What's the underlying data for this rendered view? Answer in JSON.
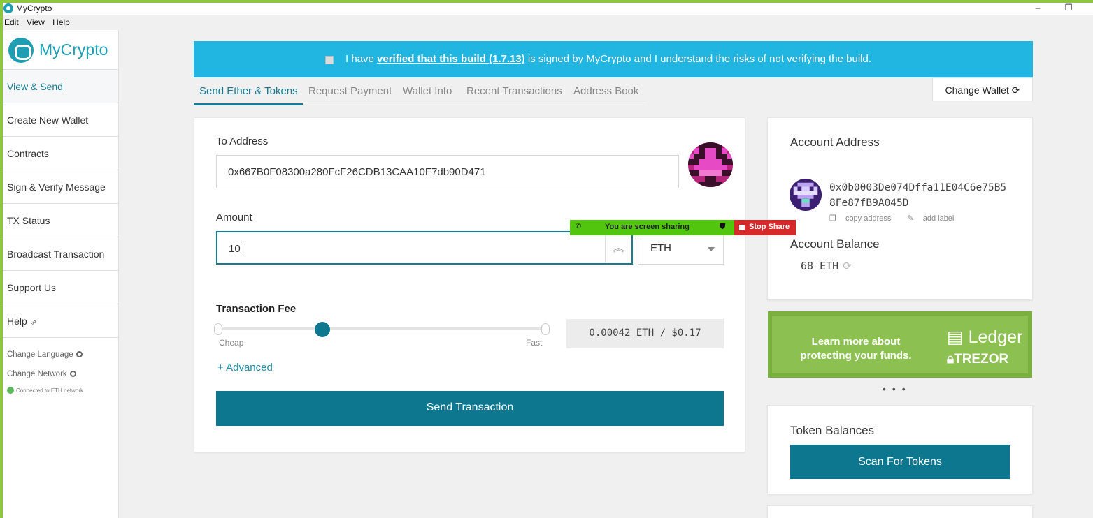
{
  "window": {
    "title": "MyCrypto",
    "minimize": "–",
    "restore": "❐"
  },
  "menu": [
    "Edit",
    "View",
    "Help"
  ],
  "sidebar": {
    "logo": "MyCrypto",
    "items": [
      {
        "label": "View & Send",
        "active": true
      },
      {
        "label": "Create New Wallet"
      },
      {
        "label": "Contracts"
      },
      {
        "label": "Sign & Verify Message"
      },
      {
        "label": "TX Status"
      },
      {
        "label": "Broadcast Transaction"
      },
      {
        "label": "Support Us"
      },
      {
        "label": "Help",
        "icon": "external-link-icon"
      }
    ],
    "change_language": "Change Language",
    "change_network": "Change Network",
    "network_status": "Connected to ETH network"
  },
  "banner": {
    "prefix": "I have ",
    "link": "verified that this build (1.7.13)",
    "suffix": " is signed by MyCrypto and I understand the risks of not verifying the build."
  },
  "tabs": [
    "Send Ether & Tokens",
    "Request Payment",
    "Wallet Info",
    "Recent Transactions",
    "Address Book"
  ],
  "change_wallet": "Change Wallet",
  "send_form": {
    "to_label": "To Address",
    "to_value": "0x667B0F08300a280FcF26CDB13CAA10F7db90D471",
    "amount_label": "Amount",
    "amount_value": "10",
    "unit": "ETH",
    "fee_label": "Transaction Fee",
    "fee_slider_level": 0.32,
    "cheap": "Cheap",
    "fast": "Fast",
    "fee_value": "0.00042 ETH / $0.17",
    "advanced": "+ Advanced",
    "send_button": "Send Transaction"
  },
  "account": {
    "title": "Account Address",
    "address": "0x0b0003De074Dffa11E04C6e75B58Fe87fB9A045D",
    "copy": "copy address",
    "add_label": "add label",
    "balance_title": "Account Balance",
    "balance": "68 ETH"
  },
  "promo": {
    "text": "Learn more about protecting your funds.",
    "brand1": "Ledger",
    "brand2": "TREZOR",
    "dots": "•••"
  },
  "tokens": {
    "title": "Token Balances",
    "scan_button": "Scan For Tokens"
  },
  "share": {
    "message": "You are screen sharing",
    "stop": "Stop Share"
  },
  "colors": {
    "accent": "#0e7790",
    "banner": "#21b5e2",
    "frame": "#8dc63f",
    "share_green": "#52c60f",
    "share_red": "#d62a2a"
  }
}
